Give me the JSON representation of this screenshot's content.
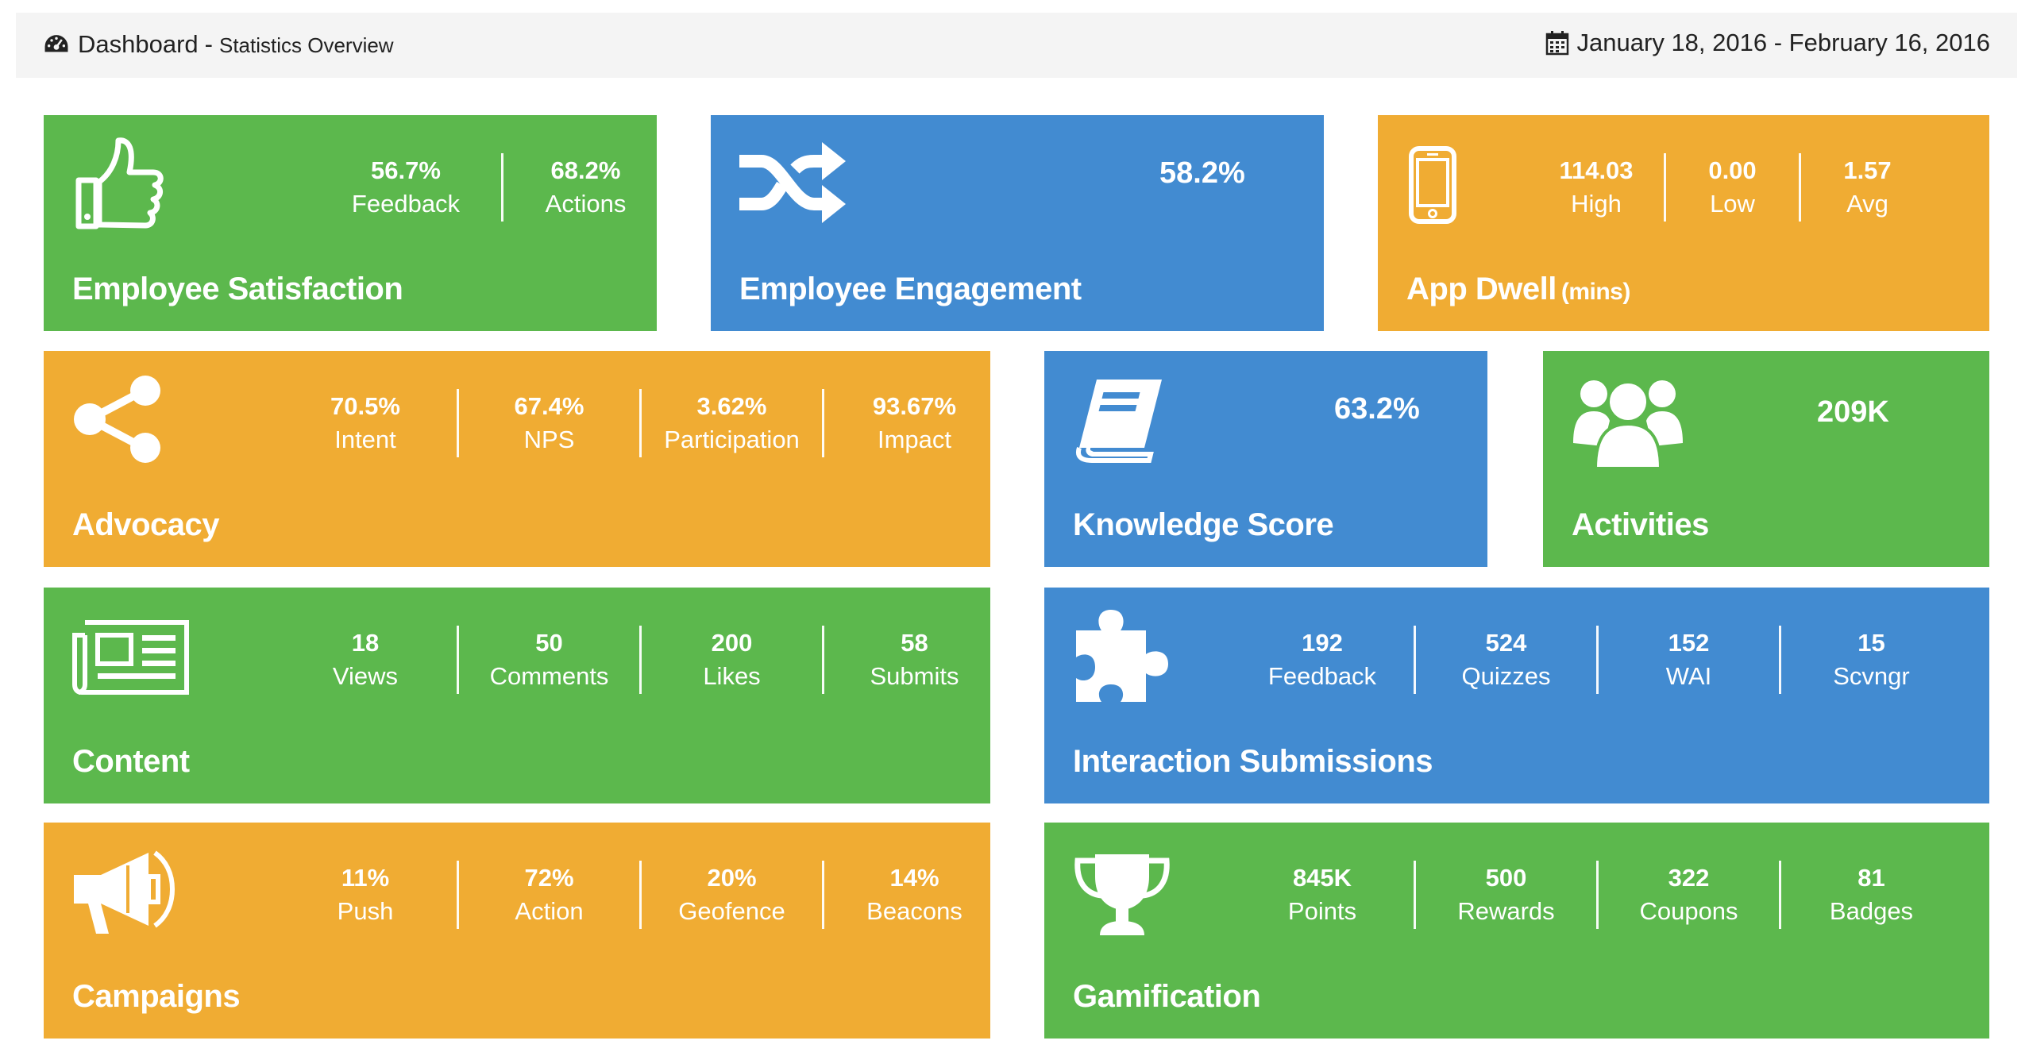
{
  "header": {
    "title": "Dashboard",
    "separator": "-",
    "subtitle": "Statistics Overview",
    "date_range": "January 18, 2016 - February 16, 2016",
    "icons": [
      "dashboard-gauge-icon",
      "calendar-icon"
    ]
  },
  "colors": {
    "green": "#5cb84d",
    "blue": "#428bd1",
    "orange": "#f0ac33",
    "header_bg": "#f4f4f4"
  },
  "tiles": {
    "satisfaction": {
      "title": "Employee Satisfaction",
      "icon": "thumbs-up-icon",
      "stats": [
        {
          "value": "56.7%",
          "label": "Feedback"
        },
        {
          "value": "68.2%",
          "label": "Actions"
        }
      ]
    },
    "engagement": {
      "title": "Employee Engagement",
      "icon": "shuffle-icon",
      "value": "58.2%"
    },
    "app_dwell": {
      "title": "App Dwell",
      "unit": "(mins)",
      "icon": "mobile-phone-icon",
      "stats": [
        {
          "value": "114.03",
          "label": "High"
        },
        {
          "value": "0.00",
          "label": "Low"
        },
        {
          "value": "1.57",
          "label": "Avg"
        }
      ]
    },
    "advocacy": {
      "title": "Advocacy",
      "icon": "share-icon",
      "stats": [
        {
          "value": "70.5%",
          "label": "Intent"
        },
        {
          "value": "67.4%",
          "label": "NPS"
        },
        {
          "value": "3.62%",
          "label": "Participation"
        },
        {
          "value": "93.67%",
          "label": "Impact"
        }
      ]
    },
    "knowledge": {
      "title": "Knowledge Score",
      "icon": "book-icon",
      "value": "63.2%"
    },
    "activities": {
      "title": "Activities",
      "icon": "users-group-icon",
      "value": "209K"
    },
    "content": {
      "title": "Content",
      "icon": "newspaper-icon",
      "stats": [
        {
          "value": "18",
          "label": "Views"
        },
        {
          "value": "50",
          "label": "Comments"
        },
        {
          "value": "200",
          "label": "Likes"
        },
        {
          "value": "58",
          "label": "Submits"
        }
      ]
    },
    "interaction": {
      "title": "Interaction Submissions",
      "icon": "puzzle-piece-icon",
      "stats": [
        {
          "value": "192",
          "label": "Feedback"
        },
        {
          "value": "524",
          "label": "Quizzes"
        },
        {
          "value": "152",
          "label": "WAI"
        },
        {
          "value": "15",
          "label": "Scvngr"
        }
      ]
    },
    "campaigns": {
      "title": "Campaigns",
      "icon": "megaphone-icon",
      "stats": [
        {
          "value": "11%",
          "label": "Push"
        },
        {
          "value": "72%",
          "label": "Action"
        },
        {
          "value": "20%",
          "label": "Geofence"
        },
        {
          "value": "14%",
          "label": "Beacons"
        }
      ]
    },
    "gamification": {
      "title": "Gamification",
      "icon": "trophy-icon",
      "stats": [
        {
          "value": "845K",
          "label": "Points"
        },
        {
          "value": "500",
          "label": "Rewards"
        },
        {
          "value": "322",
          "label": "Coupons"
        },
        {
          "value": "81",
          "label": "Badges"
        }
      ]
    }
  }
}
